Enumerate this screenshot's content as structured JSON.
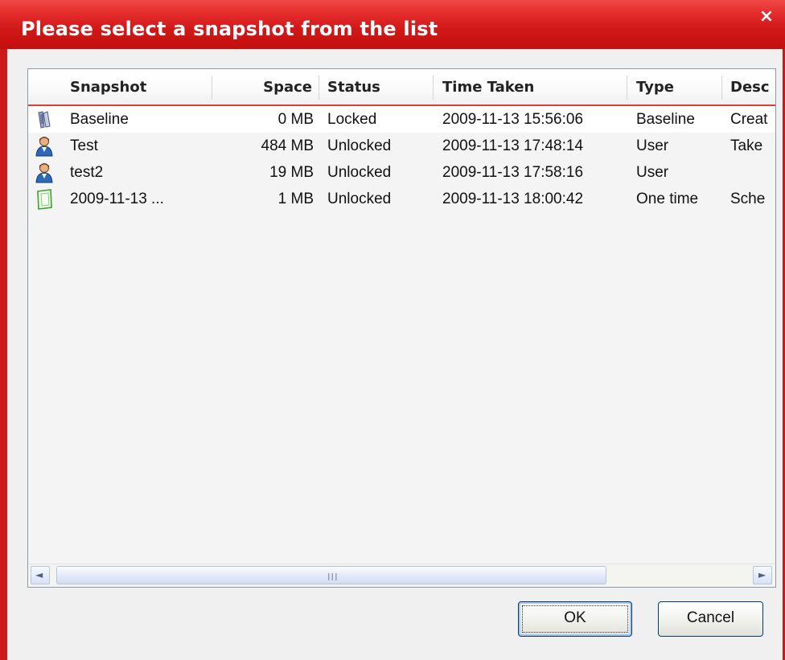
{
  "dialog": {
    "title": "Please select a snapshot from the list",
    "close_glyph": "×",
    "accent_color": "#cc1a1a"
  },
  "list": {
    "columns": [
      "Snapshot",
      "Space",
      "Status",
      "Time Taken",
      "Type",
      "Desc"
    ],
    "rows": [
      {
        "icon": "baseline-icon",
        "name": "Baseline",
        "space": "0 MB",
        "status": "Locked",
        "time": "2009-11-13 15:56:06",
        "type": "Baseline",
        "desc": "Creat"
      },
      {
        "icon": "user-icon",
        "name": "Test",
        "space": "484 MB",
        "status": "Unlocked",
        "time": "2009-11-13 17:48:14",
        "type": "User",
        "desc": "Take"
      },
      {
        "icon": "user-icon",
        "name": "test2",
        "space": "19 MB",
        "status": "Unlocked",
        "time": "2009-11-13 17:58:16",
        "type": "User",
        "desc": ""
      },
      {
        "icon": "scheduled-icon",
        "name": "2009-11-13 ...",
        "space": "1 MB",
        "status": "Unlocked",
        "time": "2009-11-13 18:00:42",
        "type": "One time",
        "desc": "Sche"
      }
    ]
  },
  "scrollbar": {
    "left_arrow": "◄",
    "right_arrow": "►",
    "grip": "III"
  },
  "buttons": {
    "ok_label": "OK",
    "cancel_label": "Cancel"
  }
}
